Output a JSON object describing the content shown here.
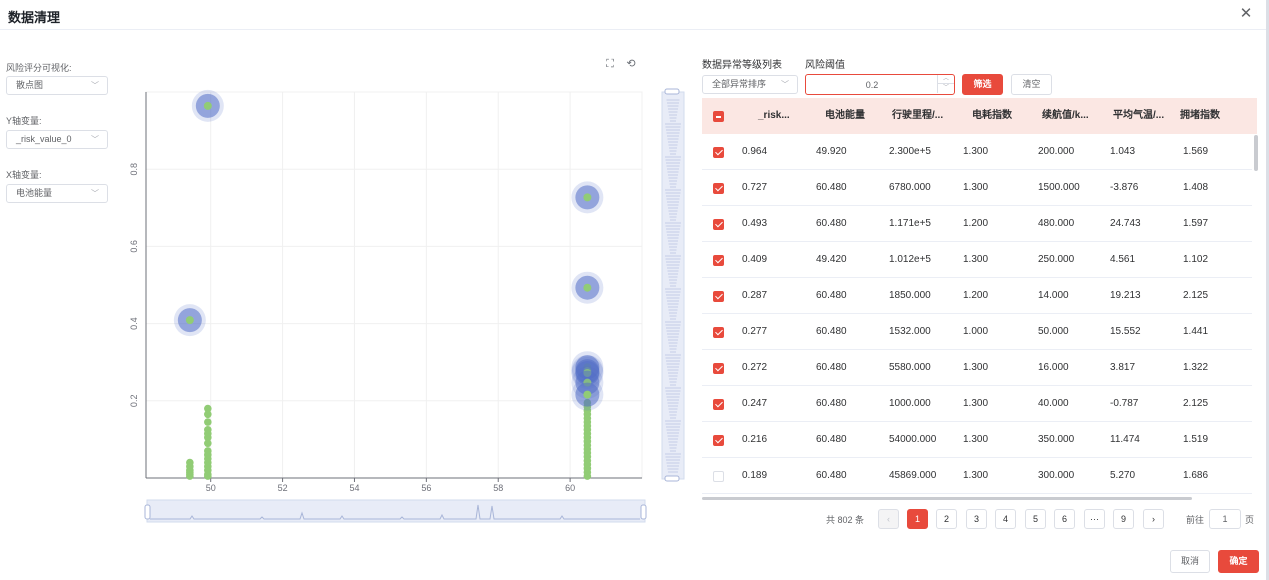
{
  "dialog": {
    "title": "数据清理",
    "close_glyph": "✕"
  },
  "controls": {
    "vis_label": "风险评分可视化:",
    "vis_value": "散点图",
    "y_label": "Y轴变量:",
    "y_value": "_risk_value_0",
    "x_label": "X轴变量:",
    "x_value": "电池能量"
  },
  "chart_toolbox": {
    "icons": [
      "zoom-box-icon",
      "reset-icon"
    ]
  },
  "chart_data": {
    "type": "scatter",
    "xlim": [
      48.2,
      62.0
    ],
    "ylim": [
      0.0,
      1.0
    ],
    "x_ticks": [
      50,
      52,
      54,
      56,
      58,
      60
    ],
    "x_tick_labels": [
      "50",
      "52",
      "54",
      "56",
      "58",
      "60"
    ],
    "y_ticks": [
      0.2,
      0.4,
      0.6,
      0.8
    ],
    "y_tick_labels": [
      "0.2",
      "0.4",
      "0.6",
      "0.8"
    ],
    "xlabel": "",
    "ylabel": "",
    "title": "",
    "grid": true,
    "highlight_color": "#5470c6",
    "normal_color": "#91cc75",
    "highlighted": [
      {
        "x": 49.92,
        "y": 0.964
      },
      {
        "x": 60.48,
        "y": 0.727
      },
      {
        "x": 60.48,
        "y": 0.493
      },
      {
        "x": 49.42,
        "y": 0.409
      },
      {
        "x": 60.48,
        "y": 0.287
      },
      {
        "x": 60.48,
        "y": 0.277
      },
      {
        "x": 60.48,
        "y": 0.272
      },
      {
        "x": 60.48,
        "y": 0.247
      },
      {
        "x": 60.48,
        "y": 0.216
      }
    ],
    "normal": [
      {
        "x": 49.92,
        "y": 0.18
      },
      {
        "x": 49.92,
        "y": 0.165
      },
      {
        "x": 49.92,
        "y": 0.145
      },
      {
        "x": 49.92,
        "y": 0.125
      },
      {
        "x": 49.92,
        "y": 0.115
      },
      {
        "x": 49.92,
        "y": 0.105
      },
      {
        "x": 49.92,
        "y": 0.09
      },
      {
        "x": 49.92,
        "y": 0.07
      },
      {
        "x": 49.92,
        "y": 0.06
      },
      {
        "x": 49.92,
        "y": 0.05
      },
      {
        "x": 49.92,
        "y": 0.04
      },
      {
        "x": 49.92,
        "y": 0.03
      },
      {
        "x": 49.92,
        "y": 0.02
      },
      {
        "x": 49.92,
        "y": 0.01
      },
      {
        "x": 49.92,
        "y": 0.005
      },
      {
        "x": 49.42,
        "y": 0.04
      },
      {
        "x": 49.42,
        "y": 0.03
      },
      {
        "x": 49.42,
        "y": 0.02
      },
      {
        "x": 49.42,
        "y": 0.015
      },
      {
        "x": 49.42,
        "y": 0.01
      },
      {
        "x": 49.42,
        "y": 0.005
      },
      {
        "x": 60.48,
        "y": 0.195
      },
      {
        "x": 60.48,
        "y": 0.185
      },
      {
        "x": 60.48,
        "y": 0.175
      },
      {
        "x": 60.48,
        "y": 0.165
      },
      {
        "x": 60.48,
        "y": 0.155
      },
      {
        "x": 60.48,
        "y": 0.145
      },
      {
        "x": 60.48,
        "y": 0.135
      },
      {
        "x": 60.48,
        "y": 0.125
      },
      {
        "x": 60.48,
        "y": 0.115
      },
      {
        "x": 60.48,
        "y": 0.105
      },
      {
        "x": 60.48,
        "y": 0.095
      },
      {
        "x": 60.48,
        "y": 0.085
      },
      {
        "x": 60.48,
        "y": 0.075
      },
      {
        "x": 60.48,
        "y": 0.065
      },
      {
        "x": 60.48,
        "y": 0.055
      },
      {
        "x": 60.48,
        "y": 0.045
      },
      {
        "x": 60.48,
        "y": 0.035
      },
      {
        "x": 60.48,
        "y": 0.025
      },
      {
        "x": 60.48,
        "y": 0.015
      },
      {
        "x": 60.48,
        "y": 0.005
      }
    ]
  },
  "table_section": {
    "list_label": "数据异常等级列表",
    "threshold_label": "风险阈值",
    "sort_value": "全部异常排序",
    "threshold_value": "0.2",
    "filter_button": "筛选",
    "clear_button": "清空",
    "accent_color": "#e84a3c",
    "header_bg": "#fbe7e3",
    "columns": [
      "_risk...",
      "电池能量",
      "行驶里程/...",
      "电耗指数",
      "续航值/k...",
      "平均气温/...",
      "拥堵指数"
    ],
    "rows": [
      {
        "checked": true,
        "cells": [
          "0.964",
          "49.920",
          "2.300e+5",
          "1.300",
          "200.000",
          "1.043",
          "1.569"
        ]
      },
      {
        "checked": true,
        "cells": [
          "0.727",
          "60.480",
          "6780.000",
          "1.300",
          "1500.000",
          "-3.876",
          "1.408"
        ]
      },
      {
        "checked": true,
        "cells": [
          "0.493",
          "60.480",
          "1.171e+5",
          "1.200",
          "480.000",
          "24.743",
          "1.597"
        ]
      },
      {
        "checked": true,
        "cells": [
          "0.409",
          "49.420",
          "1.012e+5",
          "1.300",
          "250.000",
          "4.561",
          "1.102"
        ]
      },
      {
        "checked": true,
        "cells": [
          "0.287",
          "60.480",
          "1850.000",
          "1.200",
          "14.000",
          "19.213",
          "2.125"
        ]
      },
      {
        "checked": true,
        "cells": [
          "0.277",
          "60.480",
          "1532.000",
          "1.000",
          "50.000",
          "15.552",
          "1.441"
        ]
      },
      {
        "checked": true,
        "cells": [
          "0.272",
          "60.480",
          "5580.000",
          "1.300",
          "16.000",
          "3.817",
          "1.322"
        ]
      },
      {
        "checked": true,
        "cells": [
          "0.247",
          "60.480",
          "1000.000",
          "1.300",
          "40.000",
          "-0.787",
          "2.125"
        ]
      },
      {
        "checked": true,
        "cells": [
          "0.216",
          "60.480",
          "54000.000",
          "1.300",
          "350.000",
          "11.474",
          "1.519"
        ]
      },
      {
        "checked": false,
        "cells": [
          "0.189",
          "60.480",
          "45869.000",
          "1.300",
          "300.000",
          "5.270",
          "1.686"
        ]
      }
    ]
  },
  "pagination": {
    "total": "共 802 条",
    "prev": "‹",
    "next": "›",
    "pages": [
      "1",
      "2",
      "3",
      "4",
      "5",
      "6",
      "···",
      "9"
    ],
    "active_page": "1",
    "goto_label": "前往",
    "goto_value": "1",
    "page_suffix": "页"
  },
  "footer": {
    "cancel": "取消",
    "confirm": "确定"
  }
}
